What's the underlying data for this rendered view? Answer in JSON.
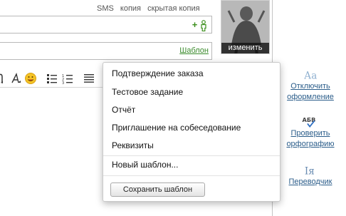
{
  "header_links": {
    "sms": "SMS",
    "copy": "копия",
    "hidden_copy": "скрытая копия"
  },
  "add_contact_plus": "+",
  "template_link": "Шаблон",
  "avatar": {
    "change_label": "изменить"
  },
  "toolbar": {
    "icons": [
      "text-format-icon",
      "font-style-icon",
      "emoticon-icon",
      "bulleted-list-icon",
      "numbered-list-icon",
      "align-icon"
    ]
  },
  "side_panel": {
    "disable_formatting": "Отключить оформление",
    "spellcheck": "Проверить орфографию",
    "spellcheck_icon_text": "АБВ",
    "translator": "Переводчик",
    "translator_icon_text": "Iя",
    "formatting_icon_text": "Аа"
  },
  "template_menu": {
    "items": [
      "Подтверждение заказа",
      "Тестовое задание",
      "Отчёт",
      "Приглашение на собеседование",
      "Реквизиты"
    ],
    "new_template": "Новый шаблон...",
    "save_template": "Сохранить шаблон"
  },
  "colors": {
    "green_accent": "#3a8a2b",
    "link_blue": "#2b5d8a"
  }
}
